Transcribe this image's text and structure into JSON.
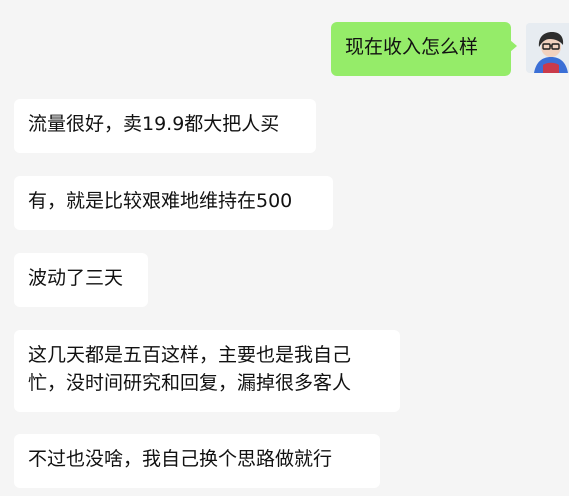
{
  "chat": {
    "messages": [
      {
        "side": "right",
        "text": "现在收入怎么样"
      },
      {
        "side": "left",
        "text": "流量很好，卖19.9都大把人买"
      },
      {
        "side": "left",
        "text": "有，就是比较艰难地维持在500"
      },
      {
        "side": "left",
        "text": "波动了三天"
      },
      {
        "side": "left",
        "lines": [
          "这几天都是五百这样，主要也是我自己",
          "忙，没时间研究和回复，漏掉很多客人"
        ]
      },
      {
        "side": "left",
        "text": "不过也没啥，我自己换个思路做就行"
      }
    ],
    "avatar_icon": "user-avatar-icon"
  },
  "colors": {
    "background": "#f5f5f5",
    "sent_bubble": "#95ec69",
    "received_bubble": "#ffffff"
  }
}
